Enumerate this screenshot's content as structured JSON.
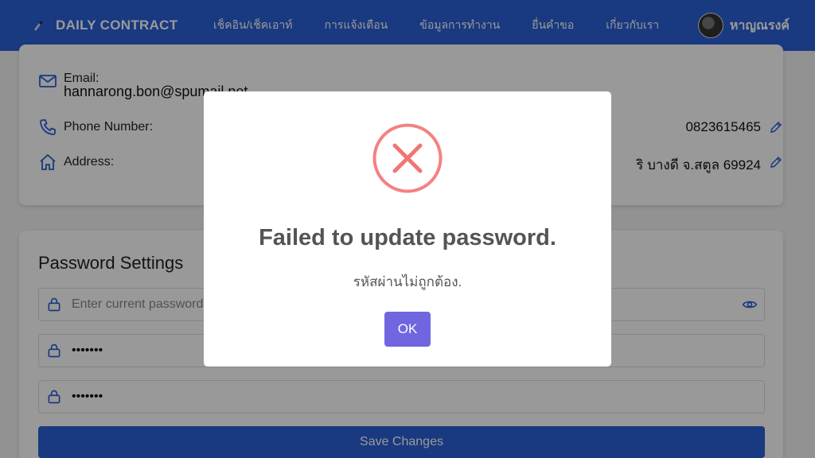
{
  "navbar": {
    "brand": "DAILY CONTRACT",
    "links": [
      "เช็คอิน/เช็คเอาท์",
      "การแจ้งเตือน",
      "ข้อมูลการทำงาน",
      "ยื่นคำขอ",
      "เกี่ยวกับเรา"
    ],
    "user_name": "หาญณรงค์"
  },
  "profile": {
    "email_label": "Email:",
    "email_value": "hannarong.bon@spumail.net",
    "phone_label": "Phone Number:",
    "phone_value": "0823615465",
    "address_label": "Address:",
    "address_value": "ริ บางดี จ.สตูล 69924"
  },
  "password_settings": {
    "title": "Password Settings",
    "current_placeholder": "Enter current password",
    "new_value": "•••••••",
    "confirm_value": "•••••••",
    "save_label": "Save Changes"
  },
  "dialog": {
    "title": "Failed to update password.",
    "message": "รหัสผ่านไม่ถูกต้อง.",
    "ok_label": "OK"
  },
  "colors": {
    "primary": "#2b5fd6",
    "error": "#f27474",
    "confirm_button": "#7066e0"
  }
}
